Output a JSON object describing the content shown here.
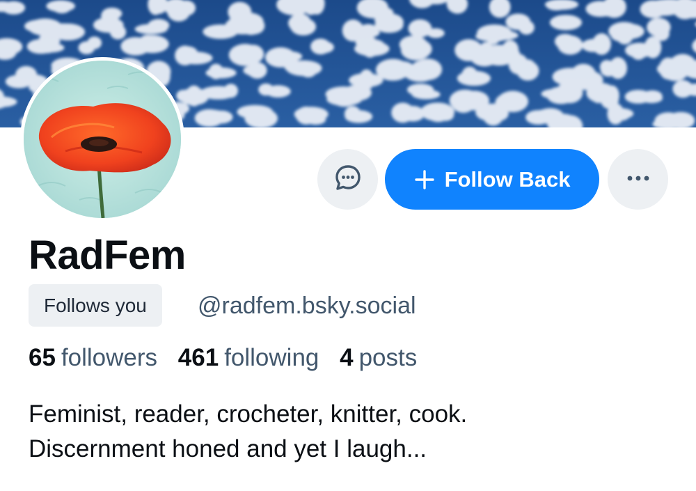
{
  "profile": {
    "display_name": "RadFem",
    "follows_you_label": "Follows you",
    "handle": "@radfem.bsky.social",
    "stats": {
      "followers_count": "65",
      "followers_label": "followers",
      "following_count": "461",
      "following_label": "following",
      "posts_count": "4",
      "posts_label": "posts"
    },
    "bio_lines": [
      "Feminist, reader, crocheter, knitter, cook.",
      "Discernment honed and yet I laugh..."
    ]
  },
  "actions": {
    "message_icon": "chat-bubble-icon",
    "follow_back_label": "Follow Back",
    "follow_icon": "plus-icon",
    "more_icon": "ellipsis-icon"
  },
  "colors": {
    "accent": "#1083fe",
    "banner_sky": "#1f4f8f",
    "secondary_text": "#42576c",
    "badge_bg": "#edf0f3"
  }
}
